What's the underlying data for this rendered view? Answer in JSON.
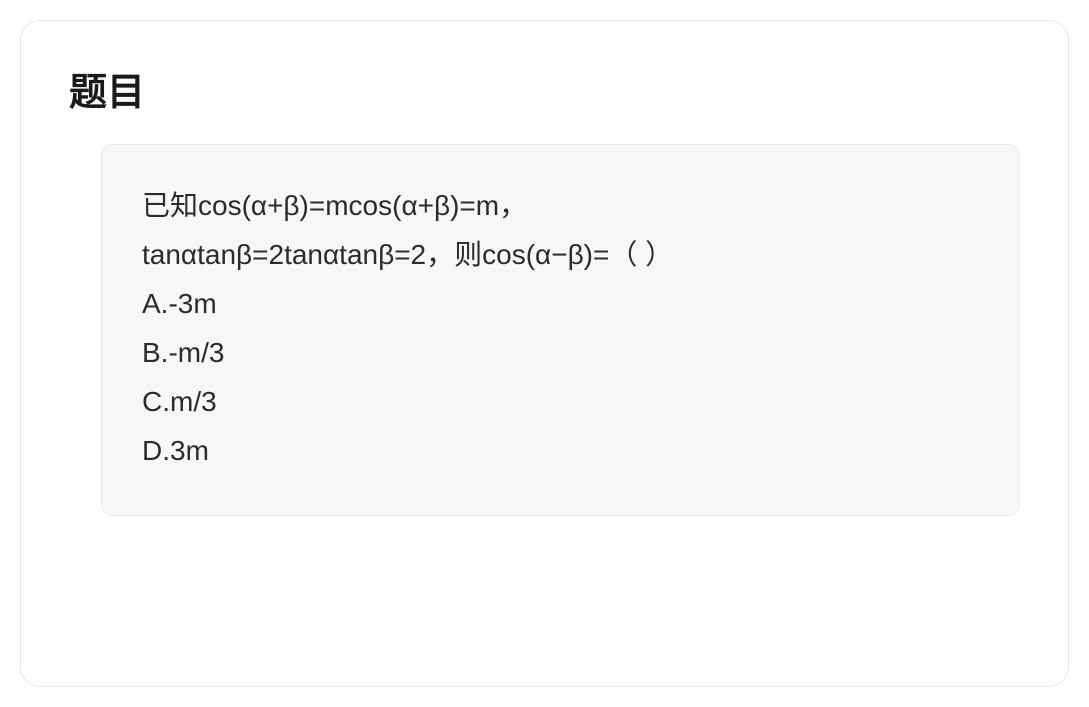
{
  "title": "题目",
  "question": {
    "stem_line1": "已知cos(α+β)=mcos(α+β)=m，",
    "stem_line2": "tanαtanβ=2tanαtanβ=2，则cos(α−β)=（ ）",
    "options": {
      "a": "A.-3m",
      "b": "B.-m/3",
      "c": "C.m/3",
      "d": "D.3m"
    }
  }
}
